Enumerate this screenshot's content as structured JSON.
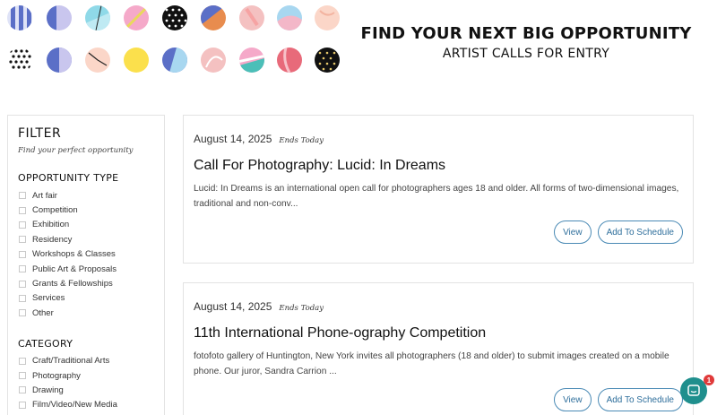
{
  "hero": {
    "title": "FIND YOUR NEXT BIG OPPORTUNITY",
    "subtitle": "ARTIST CALLS FOR ENTRY"
  },
  "decor": {
    "icon": "pattern-circles",
    "palette": [
      "#5b6fc7",
      "#c9c6ee",
      "#8fd9e8",
      "#f5a9c9",
      "#111111",
      "#e88c4e",
      "#f4c1c1",
      "#a8d7f0",
      "#fbd6c8",
      "#fbe04c",
      "#4bbfb8",
      "#e86a7a"
    ]
  },
  "sidebar": {
    "title": "FILTER",
    "subtitle": "Find your perfect opportunity",
    "type_heading": "OPPORTUNITY TYPE",
    "types": [
      "Art fair",
      "Competition",
      "Exhibition",
      "Residency",
      "Workshops & Classes",
      "Public Art & Proposals",
      "Grants & Fellowships",
      "Services",
      "Other"
    ],
    "category_heading": "CATEGORY",
    "categories": [
      "Craft/Traditional Arts",
      "Photography",
      "Drawing",
      "Film/Video/New Media"
    ]
  },
  "cards": [
    {
      "date": "August 14, 2025",
      "badge": "Ends Today",
      "title": "Call For Photography: Lucid: In Dreams",
      "description": "Lucid: In Dreams is an international open call for photographers ages 18 and older. All forms of two-dimensional images, traditional and non-conv...",
      "view_label": "View",
      "schedule_label": "Add To Schedule"
    },
    {
      "date": "August 14, 2025",
      "badge": "Ends Today",
      "title": "11th International Phone-ography Competition",
      "description": "fotofoto gallery of Huntington, New York invites all photographers (18 and older) to submit images created on a mobile phone. Our juror, Sandra Carrion ...",
      "view_label": "View",
      "schedule_label": "Add To Schedule"
    }
  ],
  "chat": {
    "icon": "chat-icon",
    "badge_count": "1",
    "color": "#1f8f8d"
  }
}
